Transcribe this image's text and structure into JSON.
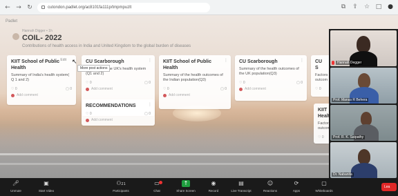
{
  "browser": {
    "url": "cutondon.padlet.org/ac8101fa111p/tmpmpuzlt"
  },
  "board": {
    "app_name": "Padlet",
    "author": "Hannah Digger • 1h",
    "title": "COIL- 2022",
    "description": "Contributions of health access in India and United Kingdom to the global burden of diseases"
  },
  "cards": [
    {
      "title": "KIIT School of Public Health",
      "body": "Summary of India's health system( Q 1 and 2)",
      "likes": "0",
      "comments_count": "0",
      "comment_placeholder": "Add comment",
      "edit_label": "Edit"
    },
    {
      "title": "CU Scarborough",
      "body": "Summary of the UK's health system (Q1 and 2)",
      "likes": "0",
      "comments_count": "0",
      "comment_placeholder": "Add comment",
      "tooltip": "More post actions"
    },
    {
      "title": "RECOMMENDATIONS",
      "body": "",
      "likes": "0",
      "comments_count": "0",
      "comment_placeholder": "Add comment"
    },
    {
      "title": "KIIT School of Public Health",
      "body": "Summary of the health outcomes of the Indian population(Q3)",
      "likes": "0",
      "comments_count": "0",
      "comment_placeholder": "Add comment"
    },
    {
      "title": "CU Scarborough",
      "body": "Summary of the health outcomes of the UK population(Q3)",
      "likes": "0",
      "comments_count": "0",
      "comment_placeholder": "Add comment"
    },
    {
      "title": "CU S",
      "body": "Factors outcom",
      "likes": "0",
      "comments_count": "",
      "comment_placeholder": ""
    },
    {
      "title": "KIIT Health",
      "body": "Factors outcom",
      "likes": "0",
      "comments_count": "",
      "comment_placeholder": ""
    }
  ],
  "participants": [
    {
      "name": "Hannah Degger"
    },
    {
      "name": "Prof. Manas R Behera"
    },
    {
      "name": "Prof. R. K. Satpathy"
    },
    {
      "name": "Dr. Nabanita"
    }
  ],
  "toolbar": {
    "unmute": "Unmute",
    "start_video": "Start Video",
    "participants": "Participants",
    "participants_count": "21",
    "chat": "Chat",
    "share_screen": "Share Screen",
    "record": "Record",
    "live_transcript": "Live Transcript",
    "reactions": "Reactions",
    "apps": "Apps",
    "whiteboards": "Whiteboards",
    "leave": "Lea"
  },
  "colors": {
    "zoom_bar": "#1a1a1a",
    "leave": "#e02828",
    "share_screen": "#1f9e3f",
    "comment_dot": "#d2585b"
  }
}
